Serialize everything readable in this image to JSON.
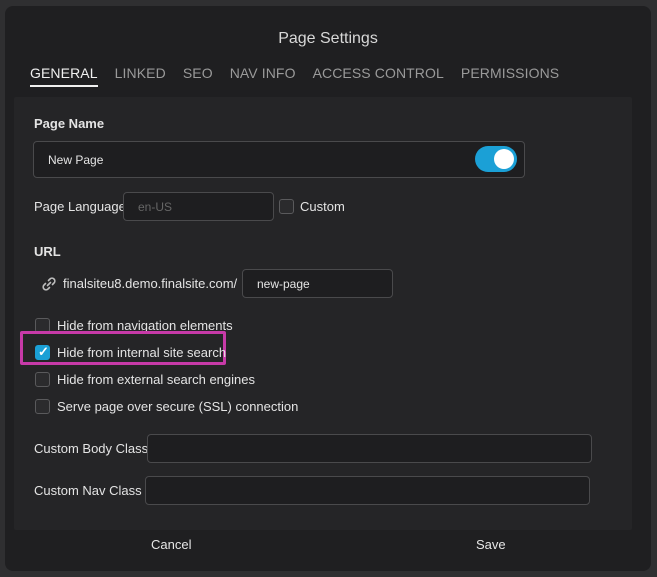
{
  "dialog": {
    "title": "Page Settings"
  },
  "tabs": [
    {
      "label": "GENERAL",
      "active": true
    },
    {
      "label": "LINKED"
    },
    {
      "label": "SEO"
    },
    {
      "label": "NAV INFO"
    },
    {
      "label": "ACCESS CONTROL"
    },
    {
      "label": "PERMISSIONS"
    }
  ],
  "page_name": {
    "label": "Page Name",
    "value": "New Page",
    "toggle_on": true
  },
  "page_language": {
    "label": "Page Language",
    "placeholder": "en-US",
    "custom_label": "Custom",
    "custom_checked": false
  },
  "url": {
    "label": "URL",
    "base": "finalsiteu8.demo.finalsite.com/",
    "slug": "new-page",
    "icon": "link-icon"
  },
  "options": [
    {
      "label": "Hide from navigation elements",
      "checked": false
    },
    {
      "label": "Hide from internal site search",
      "checked": true
    },
    {
      "label": "Hide from external search engines",
      "checked": false
    },
    {
      "label": "Serve page over secure (SSL) connection",
      "checked": false
    }
  ],
  "custom_body_class": {
    "label": "Custom Body Class",
    "value": ""
  },
  "custom_nav_class": {
    "label": "Custom Nav Class",
    "value": ""
  },
  "footer": {
    "cancel_label": "Cancel",
    "save_label": "Save"
  },
  "colors": {
    "accent": "#1ba0d6",
    "highlight": "#c73aa8"
  }
}
